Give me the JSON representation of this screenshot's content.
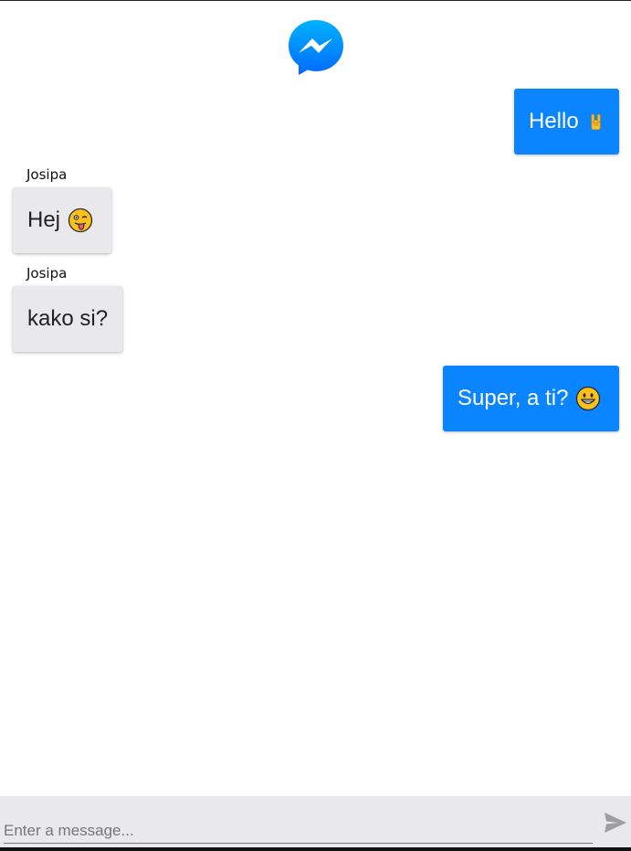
{
  "app": {
    "logo_icon": "messenger-logo-icon",
    "accent": "#0a84ff",
    "incoming_bg": "#e9e9eb"
  },
  "messages": [
    {
      "direction": "outgoing",
      "text": "Hello",
      "emoji_icon": "rock-on-hand-icon"
    },
    {
      "direction": "incoming",
      "sender": "Josipa",
      "text": "Hej",
      "emoji_icon": "winking-tongue-face-icon"
    },
    {
      "direction": "incoming",
      "sender": "Josipa",
      "text": "kako si?"
    },
    {
      "direction": "outgoing",
      "text": "Super, a ti?",
      "emoji_icon": "grinning-face-icon"
    }
  ],
  "composer": {
    "placeholder": "Enter a message...",
    "value": "",
    "send_icon": "send-icon"
  }
}
